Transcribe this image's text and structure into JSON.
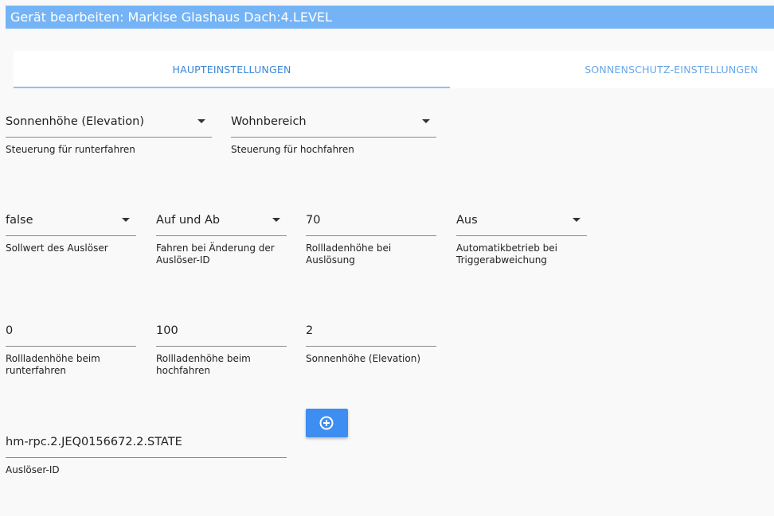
{
  "title": "Gerät bearbeiten: Markise Glashaus Dach:4.LEVEL",
  "tabs": [
    {
      "label": "HAUPTEINSTELLUNGEN"
    },
    {
      "label": "SONNENSCHUTZ-EINSTELLUNGEN"
    }
  ],
  "row1": {
    "down_control": {
      "value": "Sonnenhöhe (Elevation)",
      "label": "Steuerung für runterfahren"
    },
    "up_control": {
      "value": "Wohnbereich",
      "label": "Steuerung für hochfahren"
    }
  },
  "row2": {
    "trigger_setpoint": {
      "value": "false",
      "label": "Sollwert des Auslöser"
    },
    "drive_on_change": {
      "value": "Auf und Ab",
      "label": "Fahren bei Änderung der Auslöser-ID"
    },
    "shutter_height_trigger": {
      "value": "70",
      "label": "Rollladenhöhe bei Auslösung"
    },
    "auto_mode": {
      "value": "Aus",
      "label": "Automatikbetrieb bei Triggerabweichung"
    }
  },
  "row3": {
    "height_down": {
      "value": "0",
      "label": "Rollladenhöhe beim runterfahren"
    },
    "height_up": {
      "value": "100",
      "label": "Rollladenhöhe beim hochfahren"
    },
    "elevation": {
      "value": "2",
      "label": "Sonnenhöhe (Elevation)"
    }
  },
  "row4": {
    "trigger_id": {
      "value": "hm-rpc.2.JEQ0156672.2.STATE",
      "label": "Auslöser-ID"
    }
  },
  "add_button": {
    "icon": "plus-circle-icon"
  },
  "colors": {
    "titlebar": "#74b4f6",
    "tab_active": "#3a86d8",
    "button": "#3d8ef0"
  }
}
